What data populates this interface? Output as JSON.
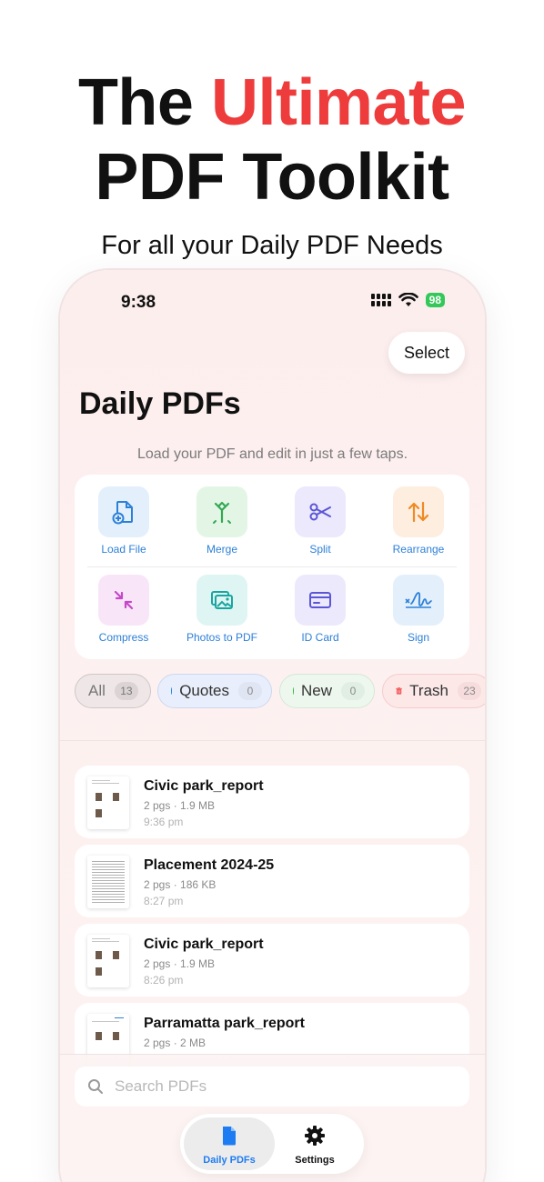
{
  "headline": {
    "word1": "The",
    "accent": "Ultimate",
    "line2": "PDF Toolkit"
  },
  "tagline": "For all your Daily PDF Needs",
  "status": {
    "time": "9:38",
    "battery": "98"
  },
  "header": {
    "select_label": "Select",
    "title": "Daily PDFs",
    "subtitle": "Load your PDF and edit in just a few taps."
  },
  "tools": [
    {
      "label": "Load File",
      "icon": "load-file-icon",
      "color": "#2d80d8",
      "bg": "#e3f0fc"
    },
    {
      "label": "Merge",
      "icon": "merge-icon",
      "color": "#34a853",
      "bg": "#e3f6e6"
    },
    {
      "label": "Split",
      "icon": "scissors-icon",
      "color": "#5b56d6",
      "bg": "#ebe9fb"
    },
    {
      "label": "Rearrange",
      "icon": "rearrange-icon",
      "color": "#f08a24",
      "bg": "#fdeedf"
    },
    {
      "label": "Compress",
      "icon": "compress-icon",
      "color": "#c548c9",
      "bg": "#f8e6f8"
    },
    {
      "label": "Photos to PDF",
      "icon": "photos-icon",
      "color": "#1aa6a0",
      "bg": "#dff5f3"
    },
    {
      "label": "ID Card",
      "icon": "id-card-icon",
      "color": "#5b56d6",
      "bg": "#ebe9fb"
    },
    {
      "label": "Sign",
      "icon": "signature-icon",
      "color": "#2d80d8",
      "bg": "#e3f0fc"
    }
  ],
  "filters": [
    {
      "label": "All",
      "count": "13"
    },
    {
      "label": "Quotes",
      "count": "0"
    },
    {
      "label": "New",
      "count": "0"
    },
    {
      "label": "Trash",
      "count": "23"
    }
  ],
  "files": [
    {
      "name": "Civic park_report",
      "meta": "2 pgs · 1.9 MB",
      "time": "9:36 pm"
    },
    {
      "name": "Placement 2024-25",
      "meta": "2 pgs · 186 KB",
      "time": "8:27 pm"
    },
    {
      "name": "Civic park_report",
      "meta": "2 pgs · 1.9 MB",
      "time": "8:26 pm"
    },
    {
      "name": "Parramatta park_report",
      "meta": "2 pgs · 2 MB",
      "time": ""
    }
  ],
  "search": {
    "placeholder": "Search PDFs"
  },
  "tabs": [
    {
      "label": "Daily PDFs"
    },
    {
      "label": "Settings"
    }
  ]
}
